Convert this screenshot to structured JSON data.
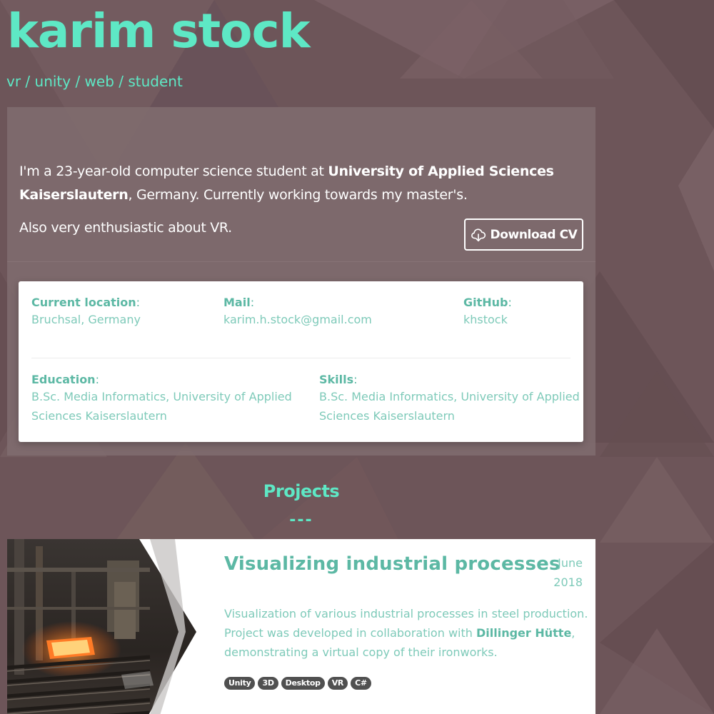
{
  "header": {
    "title": "karim stock",
    "tagline": "vr / unity / web / student"
  },
  "about": {
    "intro_part1": "I'm a 23-year-old computer science student at ",
    "intro_bold1": "University of Applied Sciences Kaiserslautern",
    "intro_part2": ", Germany. Currently working towards my master's.",
    "vr_line": "Also very enthusiastic about VR.",
    "download_cv_label": "Download CV"
  },
  "info": {
    "location": {
      "label": "Current location",
      "value": "Bruchsal, Germany"
    },
    "mail": {
      "label": "Mail",
      "value": "karim.h.stock@gmail.com"
    },
    "github": {
      "label": "GitHub",
      "value": "khstock"
    },
    "education": {
      "label": "Education",
      "value": "B.Sc. Media Informatics, University of Applied Sciences Kaiserslautern"
    },
    "skills": {
      "label": "Skills",
      "value": "B.Sc. Media Informatics, University of Applied Sciences Kaiserslautern"
    }
  },
  "projects": {
    "heading": "Projects",
    "divider": "---",
    "items": [
      {
        "title": "Visualizing industrial processes",
        "date_month": "June",
        "date_year": "2018",
        "desc_part1": "Visualization of various industrial processes in steel production. Project was developed in collaboration with ",
        "desc_bold": "Dillinger Hütte",
        "desc_part2": ", demonstrating a virtual copy of their ironworks.",
        "tags": [
          "Unity",
          "3D",
          "Desktop",
          "VR",
          "C#"
        ]
      }
    ]
  },
  "colors": {
    "accent": "#5ee8c5",
    "accent_dark": "#5cb8a4",
    "background": "#6d5559",
    "panel": "#806c6e",
    "tag_bg": "#505050"
  },
  "icons": {
    "download": "cloud-download-icon"
  }
}
